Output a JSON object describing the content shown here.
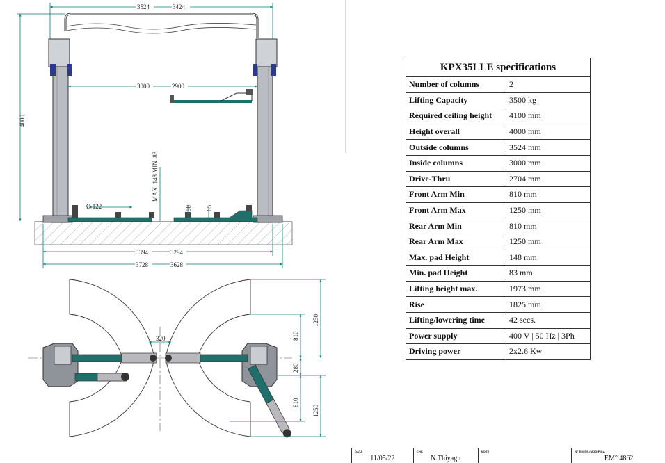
{
  "diagram": {
    "front_view": {
      "top_width_outside": "3524",
      "top_width_inside_a": "3424",
      "height_overall": "4000",
      "inner_width_a": "3000",
      "inner_width_b": "2900",
      "pad_height_label": "MAX. 148 MIN. 83",
      "pad_diameter": "Ø 122",
      "dim_50": "50",
      "dim_65": "65",
      "bottom_inner_a": "3394",
      "bottom_inner_b": "3294",
      "bottom_outer_a": "3728",
      "bottom_outer_b": "3628"
    },
    "top_view": {
      "arm_reach_upper": "1250",
      "arm_len_upper": "810",
      "center_gap": "320",
      "column_gap": "280",
      "arm_len_lower": "810",
      "arm_reach_lower": "1250"
    }
  },
  "spec_table": {
    "title": "KPX35LLE specifications",
    "rows": [
      {
        "label": "Number of columns",
        "value": "2"
      },
      {
        "label": "Lifting Capacity",
        "value": "3500 kg"
      },
      {
        "label": "Required ceiling height",
        "value": "4100 mm"
      },
      {
        "label": "Height overall",
        "value": "4000 mm"
      },
      {
        "label": "Outside columns",
        "value": "3524 mm"
      },
      {
        "label": "Inside columns",
        "value": "3000 mm"
      },
      {
        "label": "Drive-Thru",
        "value": "2704 mm"
      },
      {
        "label": "Front Arm Min",
        "value": "810 mm"
      },
      {
        "label": "Front Arm Max",
        "value": "1250 mm"
      },
      {
        "label": "Rear Arm Min",
        "value": "810 mm"
      },
      {
        "label": "Rear Arm Max",
        "value": "1250 mm"
      },
      {
        "label": "Max. pad Height",
        "value": "148 mm"
      },
      {
        "label": "Min. pad Height",
        "value": "83 mm"
      },
      {
        "label": "Lifting height max.",
        "value": "1973 mm"
      },
      {
        "label": "Rise",
        "value": "1825 mm"
      },
      {
        "label": "Lifting/lowering time",
        "value": "42 secs."
      },
      {
        "label": "Power supply",
        "value": "400 V | 50 Hz | 3Ph"
      },
      {
        "label": "Driving power",
        "value": "2x2.6 Kw"
      }
    ]
  },
  "title_block": {
    "date_caption": "DATA",
    "date_value": "11/05/22",
    "by_caption": "CHK",
    "by_value": "N.Thiyagu",
    "note_caption": "NOTE",
    "note_value": "",
    "change_caption": "N° EMISS./MODIFICA",
    "change_value": "EM° 4862"
  },
  "colors": {
    "line": "#222222",
    "dim_line": "#0f7a80",
    "column_fill": "#b9bcc2",
    "arm_teal": "#1f6f6c",
    "carriage_gray": "#b8b8bd",
    "motor_blue": "#2b3a8a",
    "floor_hatch": "#9a9a9a"
  }
}
